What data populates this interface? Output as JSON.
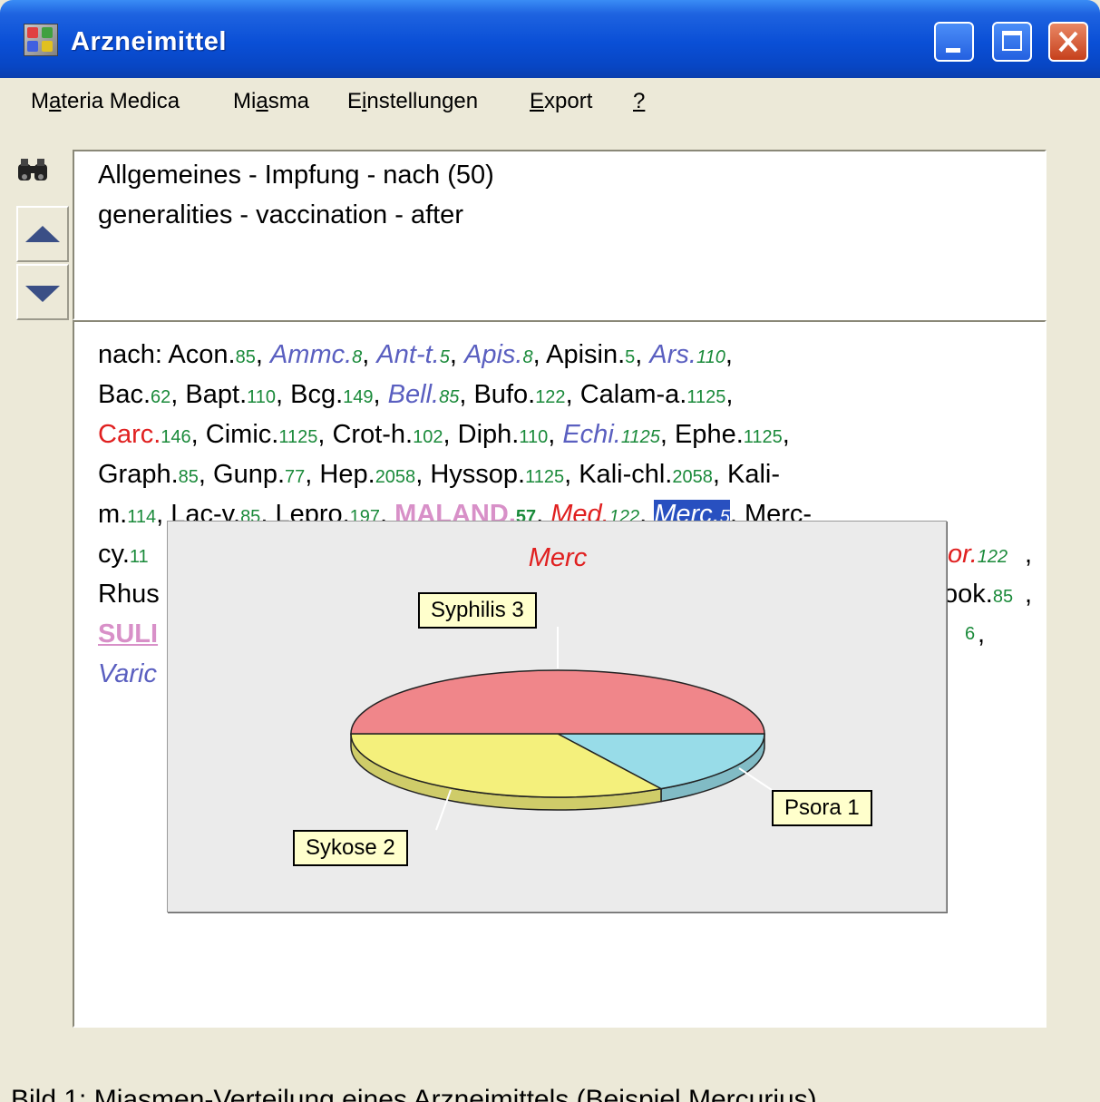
{
  "window": {
    "title": "Arzneimittel",
    "buttons": [
      "minimize",
      "maximize",
      "close"
    ]
  },
  "menu": [
    {
      "label": "Materia Medica",
      "accel_index": 1
    },
    {
      "label": "Miasma",
      "accel_index": 2
    },
    {
      "label": "Einstellungen",
      "accel_index": 1
    },
    {
      "label": "Export",
      "accel_index": 0
    },
    {
      "label": "?",
      "accel_index": 0
    }
  ],
  "toolbar": {
    "icons": [
      "binoculars-icon",
      "up-arrow-icon",
      "down-arrow-icon"
    ]
  },
  "rubric": {
    "line1": "Allgemeines - Impfung - nach (50)",
    "line2": "generalities - vaccination - after"
  },
  "remedies": {
    "prefix": "nach: ",
    "items": [
      {
        "name": "Acon.",
        "num": "85",
        "style": "plain"
      },
      {
        "name": "Ammc.",
        "num": "8",
        "style": "it-blue"
      },
      {
        "name": "Ant-t.",
        "num": "5",
        "style": "it-blue"
      },
      {
        "name": "Apis.",
        "num": "8",
        "style": "it-blue"
      },
      {
        "name": "Apisin.",
        "num": "5",
        "style": "plain"
      },
      {
        "name": "Ars.",
        "num": "110",
        "style": "it-blue"
      },
      {
        "name": "Bac.",
        "num": "62",
        "style": "plain"
      },
      {
        "name": "Bapt.",
        "num": "110",
        "style": "plain"
      },
      {
        "name": "Bcg.",
        "num": "149",
        "style": "plain"
      },
      {
        "name": "Bell.",
        "num": "85",
        "style": "it-blue"
      },
      {
        "name": "Bufo.",
        "num": "122",
        "style": "plain"
      },
      {
        "name": "Calam-a.",
        "num": "1125",
        "style": "plain"
      },
      {
        "name": "Carc.",
        "num": "146",
        "style": "red"
      },
      {
        "name": "Cimic.",
        "num": "1125",
        "style": "plain"
      },
      {
        "name": "Crot-h.",
        "num": "102",
        "style": "plain"
      },
      {
        "name": "Diph.",
        "num": "110",
        "style": "plain"
      },
      {
        "name": "Echi.",
        "num": "1125",
        "style": "it-blue"
      },
      {
        "name": "Ephe.",
        "num": "1125",
        "style": "plain"
      },
      {
        "name": "Graph.",
        "num": "85",
        "style": "plain"
      },
      {
        "name": "Gunp.",
        "num": "77",
        "style": "plain"
      },
      {
        "name": "Hep.",
        "num": "2058",
        "style": "plain"
      },
      {
        "name": "Hyssop.",
        "num": "1125",
        "style": "plain"
      },
      {
        "name": "Kali-chl.",
        "num": "2058",
        "style": "plain"
      },
      {
        "name": "Kali-m.",
        "num": "114",
        "style": "plain"
      },
      {
        "name": "Lac-v.",
        "num": "85",
        "style": "plain"
      },
      {
        "name": "Lepro.",
        "num": "197",
        "style": "plain"
      },
      {
        "name": "MALAND.",
        "num": "57",
        "style": "pink-bold"
      },
      {
        "name": "Med.",
        "num": "122",
        "style": "red-it"
      },
      {
        "name": "Merc.",
        "num": "5",
        "style": "sel"
      },
      {
        "name": "Merc-",
        "num": "",
        "style": "plain"
      }
    ],
    "fragments": {
      "cy": "cy.11",
      "or": "or.",
      "or_num": "122",
      "rhus": "Rhus",
      "ook": "ook.",
      "ook_num": "85",
      "sul": "SULI",
      "six": "6",
      "varic": "Varic"
    }
  },
  "chart_data": {
    "type": "pie",
    "title": "Merc",
    "slices": [
      {
        "label": "Syphilis 3",
        "name": "Syphilis",
        "value": 3,
        "color": "#f0868a"
      },
      {
        "label": "Sykose 2",
        "name": "Sykose",
        "value": 2,
        "color": "#f4f07c"
      },
      {
        "label": "Psora 1",
        "name": "Psora",
        "value": 1,
        "color": "#98dce8"
      }
    ]
  },
  "caption": "Bild 1: Miasmen-Verteilung eines Arzneimittels (Beispiel Mercurius)"
}
